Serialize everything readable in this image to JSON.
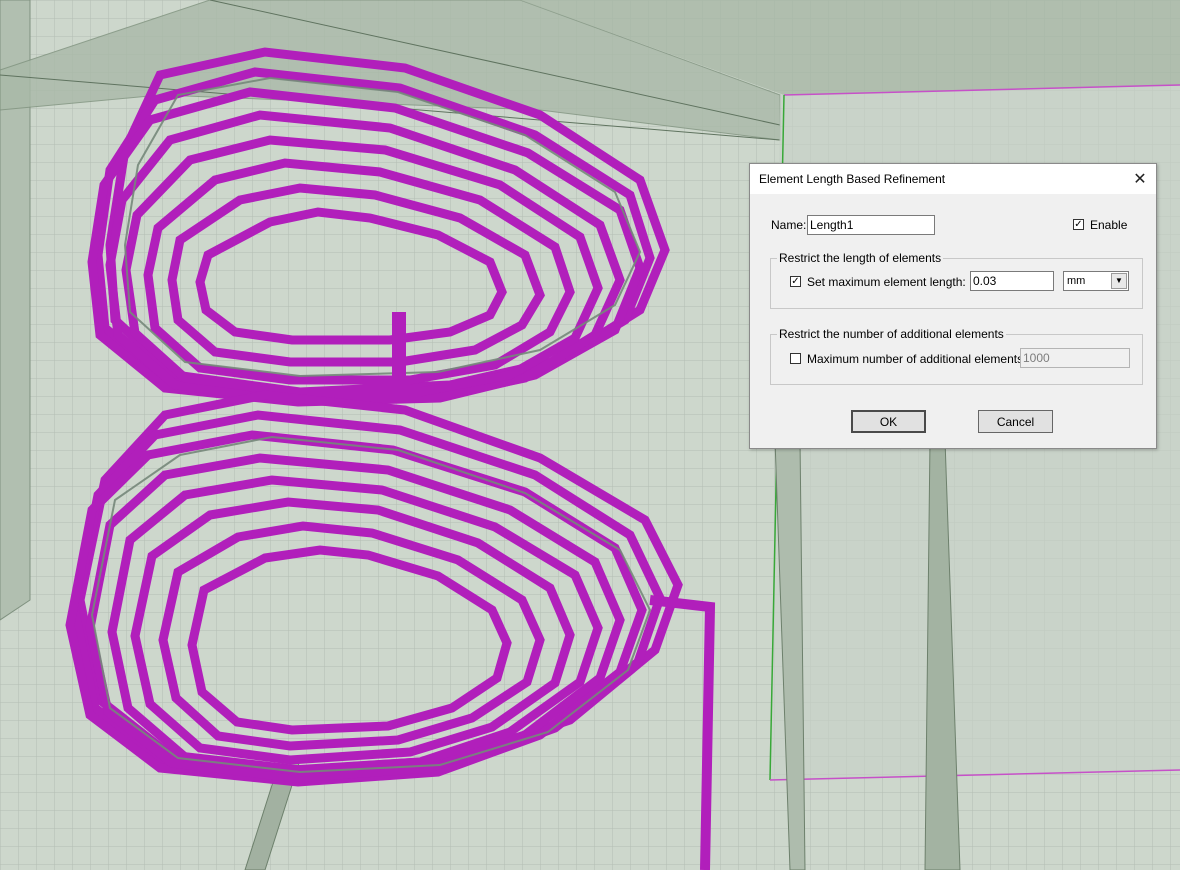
{
  "viewport": {
    "background_color": "#c9d3c8",
    "coil_color": "#b01fb8",
    "coil_edge_color": "#6f8a73"
  },
  "dialog": {
    "title": "Element Length Based Refinement",
    "close_icon": "close-icon",
    "name_label": "Name:",
    "name_value": "Length1",
    "enable_label": "Enable",
    "enable_checked": true,
    "group_length": {
      "legend": "Restrict the length of elements",
      "checkbox_label": "Set maximum element length:",
      "checked": true,
      "value": "0.03",
      "unit": "mm"
    },
    "group_count": {
      "legend": "Restrict the number of additional elements",
      "checkbox_label": "Maximum number of additional elements:",
      "checked": false,
      "value": "1000"
    },
    "ok_label": "OK",
    "cancel_label": "Cancel"
  }
}
